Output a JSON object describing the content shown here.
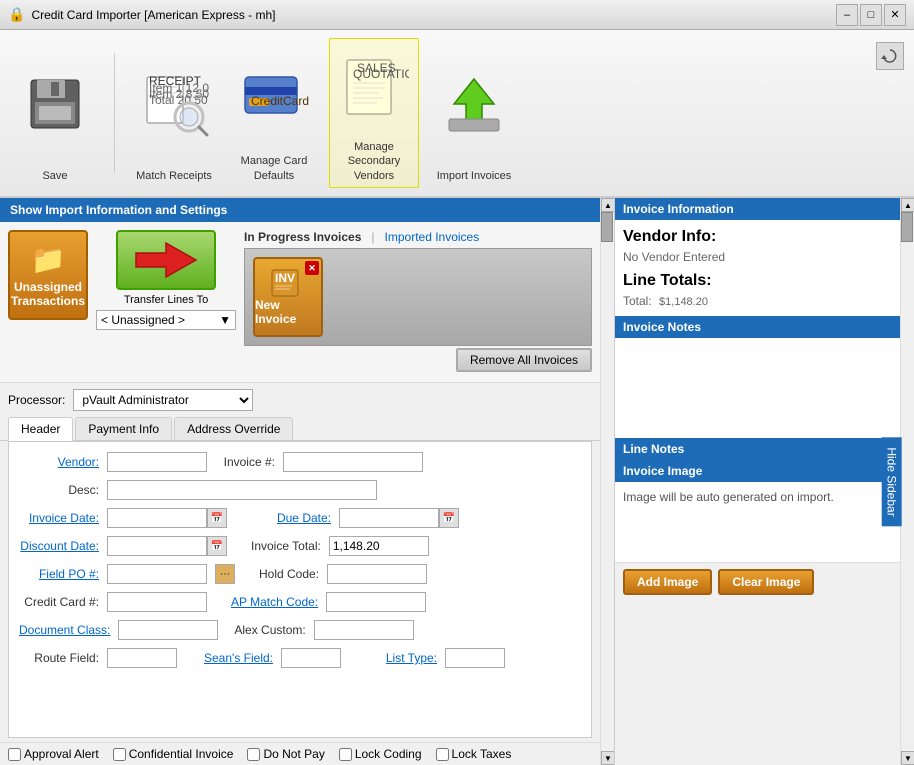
{
  "window": {
    "title": "Credit Card Importer [American Express - mh]",
    "icon": "🔒"
  },
  "toolbar": {
    "save_label": "Save",
    "match_label": "Match Receipts",
    "manage_card_label": "Manage Card Defaults",
    "manage_vendors_label": "Manage Secondary Vendors",
    "import_label": "Import Invoices"
  },
  "import_bar": {
    "label": "Show Import Information and Settings"
  },
  "invoice_section": {
    "in_progress_label": "In Progress Invoices",
    "separator": "|",
    "imported_label": "Imported Invoices",
    "unassigned_btn_label": "Unassigned Transactions",
    "transfer_label": "Transfer Lines To",
    "unassigned_dropdown": "< Unassigned >",
    "new_invoice_label": "New Invoice",
    "remove_all_label": "Remove All Invoices"
  },
  "processor": {
    "label": "Processor:",
    "value": "pVault Administrator"
  },
  "tabs": [
    {
      "label": "Header",
      "active": true
    },
    {
      "label": "Payment Info",
      "active": false
    },
    {
      "label": "Address Override",
      "active": false
    }
  ],
  "form": {
    "vendor_label": "Vendor:",
    "vendor_value": "",
    "invoice_num_label": "Invoice #:",
    "invoice_num_value": "",
    "desc_label": "Desc:",
    "desc_value": "",
    "invoice_date_label": "Invoice Date:",
    "invoice_date_value": "",
    "due_date_label": "Due Date:",
    "due_date_value": "",
    "discount_date_label": "Discount Date:",
    "discount_date_value": "",
    "invoice_total_label": "Invoice Total:",
    "invoice_total_value": "1,148.20",
    "field_po_label": "Field PO #:",
    "field_po_value": "",
    "hold_code_label": "Hold Code:",
    "hold_code_value": "",
    "credit_card_label": "Credit Card #:",
    "credit_card_value": "",
    "ap_match_label": "AP Match Code:",
    "ap_match_value": "",
    "document_class_label": "Document Class:",
    "document_class_value": "",
    "alex_custom_label": "Alex Custom:",
    "alex_custom_value": "",
    "route_field_label": "Route Field:",
    "route_field_value": "",
    "seans_field_label": "Sean's Field:",
    "seans_field_value": "",
    "list_type_label": "List Type:",
    "list_type_value": ""
  },
  "checkboxes": [
    {
      "label": "Approval Alert",
      "checked": false
    },
    {
      "label": "Confidential Invoice",
      "checked": false
    },
    {
      "label": "Do Not Pay",
      "checked": false
    },
    {
      "label": "Lock Coding",
      "checked": false
    },
    {
      "label": "Lock Taxes",
      "checked": false
    }
  ],
  "sidebar": {
    "hide_label": "Hide Sidebar",
    "invoice_info_header": "Invoice Information",
    "vendor_info_header": "Vendor Info:",
    "no_vendor_label": "No Vendor Entered",
    "line_totals_header": "Line Totals:",
    "total_label": "Total:",
    "total_value": "$1,148.20",
    "invoice_notes_header": "Invoice Notes",
    "line_notes_header": "Line Notes",
    "invoice_image_header": "Invoice Image",
    "image_auto_text": "Image will be auto generated on import.",
    "add_image_label": "Add Image",
    "clear_image_label": "Clear Image"
  }
}
